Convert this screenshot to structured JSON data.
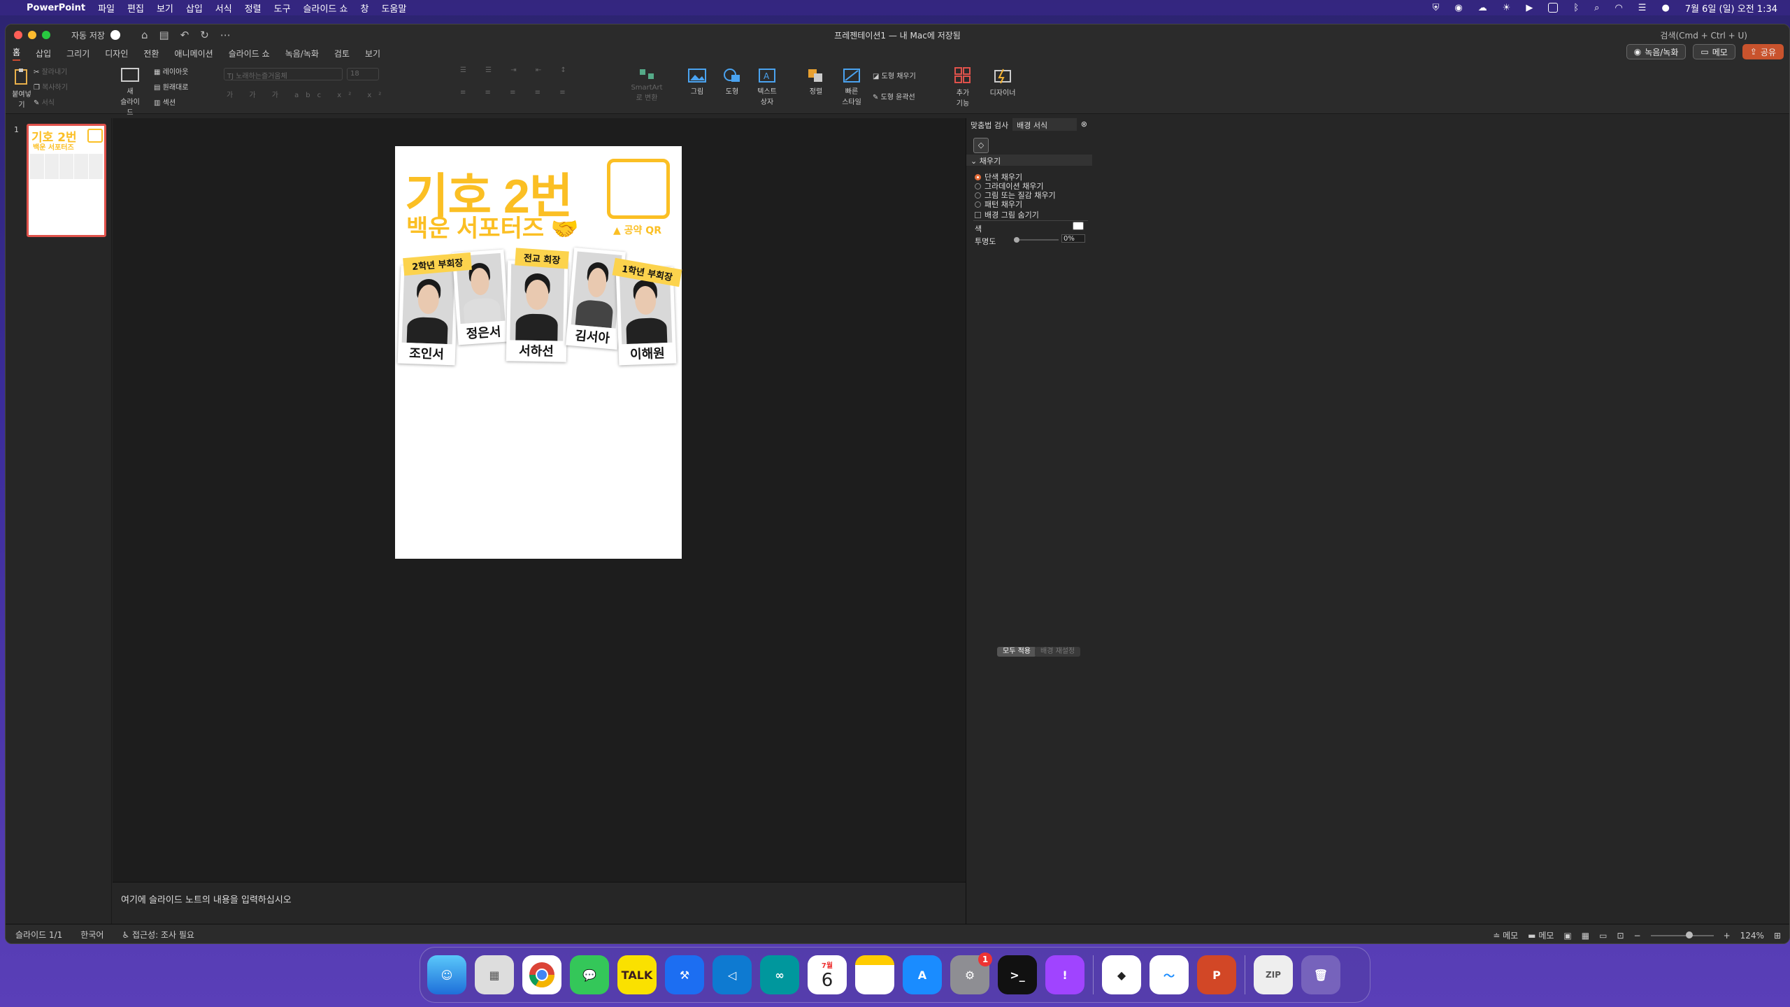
{
  "menubar": {
    "app": "PowerPoint",
    "items": [
      "파일",
      "편집",
      "보기",
      "삽입",
      "서식",
      "정렬",
      "도구",
      "슬라이드 쇼",
      "창",
      "도움말"
    ],
    "clock": "7월 6일 (일) 오전 1:34"
  },
  "titlebar": {
    "autosave": "자동 저장",
    "doc_title": "프레젠테이션1 — 내 Mac에 저장됨",
    "search": "검색(Cmd + Ctrl + U)"
  },
  "ribbon_tabs": [
    "홈",
    "삽입",
    "그리기",
    "디자인",
    "전환",
    "애니메이션",
    "슬라이드 쇼",
    "녹음/녹화",
    "검토",
    "보기"
  ],
  "ribbon_right": {
    "record": "녹음/녹화",
    "comment": "메모",
    "share": "공유"
  },
  "ribbon": {
    "paste": "붙여넣기",
    "cut": "잘라내기",
    "copy": "복사하기",
    "format": "서식",
    "new_slide": "새\n슬라이드",
    "layout": "레이아웃",
    "reset": "원래대로",
    "section": "섹션",
    "font": "TJ 노래하는즐거움체",
    "font_size": "18",
    "smartart": "SmartArt\n로 변환",
    "picture": "그림",
    "shape": "도형",
    "textbox": "텍스트\n상자",
    "arrange": "정렬",
    "quick_styles": "빠른\n스타일",
    "shape_fill": "도형 채우기",
    "shape_outline": "도형 윤곽선",
    "addins": "추가\n기능",
    "designer": "디자이너"
  },
  "slide_panel": {
    "number": "1"
  },
  "slide": {
    "title": "기호 2번",
    "subtitle": "백운 서포터즈",
    "qr_label": "공약 QR",
    "tapes": [
      "2학년 부회장",
      "전교 회장",
      "1학년 부회장"
    ],
    "names": [
      "조인서",
      "정은서",
      "서하선",
      "김서아",
      "이해원"
    ]
  },
  "notes": {
    "placeholder": "여기에 슬라이드 노트의 내용을 입력하십시오"
  },
  "pane": {
    "tabs": [
      "맞춤법 검사",
      "배경 서식"
    ],
    "section": "채우기",
    "options": [
      "단색 채우기",
      "그라데이션 채우기",
      "그림 또는 질감 채우기",
      "패턴 채우기"
    ],
    "hide_bg": "배경 그림 숨기기",
    "color_label": "색",
    "transparency_label": "투명도",
    "transparency_value": "0%",
    "transparency": 0,
    "apply_all": "모두 적용",
    "reset_bg": "배경 재설정"
  },
  "status": {
    "slide": "슬라이드 1/1",
    "language": "한국어",
    "accessibility": "접근성: 조사 필요",
    "notes": "메모",
    "comments": "메모",
    "zoom": "124%"
  },
  "dock": {
    "calendar_month": "7월",
    "calendar_day": "6",
    "settings_badge": "1",
    "kakao": "TALK"
  },
  "colors": {
    "accent": "#fbbf24",
    "share": "#c9532d",
    "selection": "#e0524b"
  }
}
